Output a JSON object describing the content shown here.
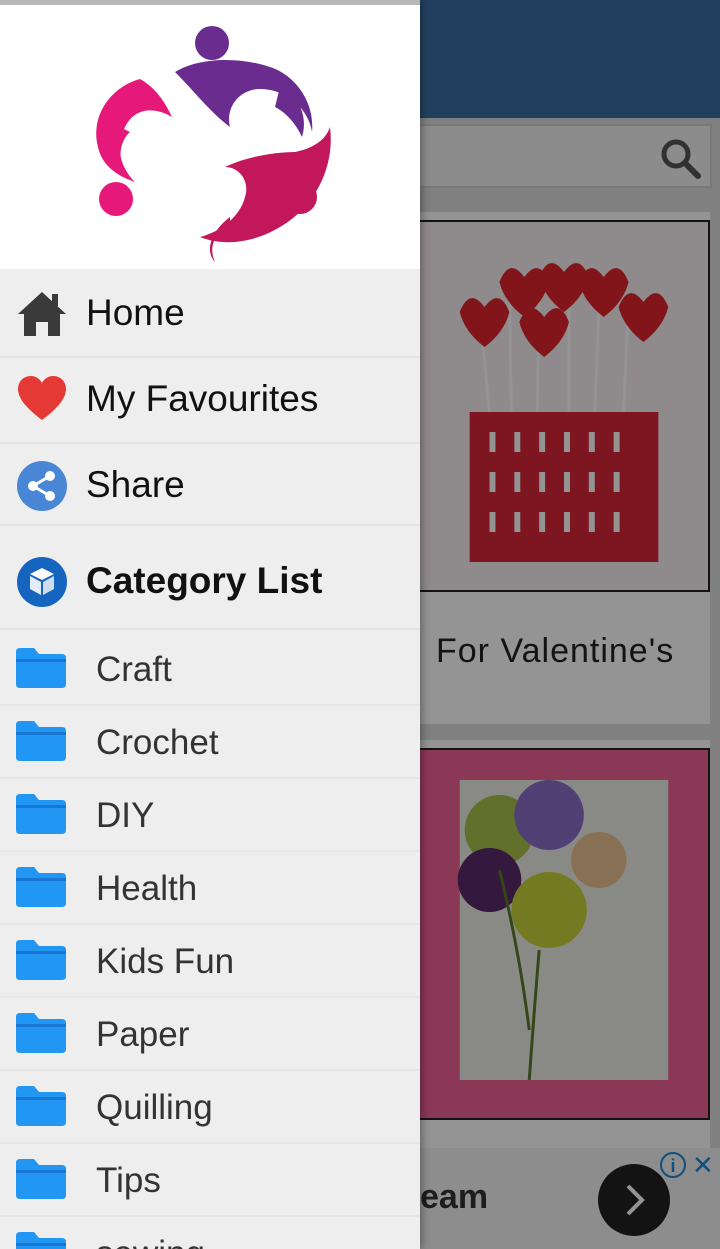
{
  "background_app": {
    "search_icon": "search-icon",
    "card1_title": "For  Valentine's",
    "ad": {
      "text": "eam",
      "info_icon": "info-icon",
      "info_glyph": "i",
      "close_glyph": "✕",
      "next_glyph": "›"
    }
  },
  "drawer": {
    "logo_icon": "community-people-logo",
    "nav_items": [
      {
        "label": "Home",
        "icon": "home-icon"
      },
      {
        "label": "My Favourites",
        "icon": "heart-icon"
      },
      {
        "label": "Share",
        "icon": "share-icon"
      }
    ],
    "category_header": {
      "label": "Category List",
      "icon": "category-cube-icon"
    },
    "categories": [
      {
        "label": "Craft"
      },
      {
        "label": "Crochet"
      },
      {
        "label": "DIY"
      },
      {
        "label": "Health"
      },
      {
        "label": "Kids Fun"
      },
      {
        "label": "Paper"
      },
      {
        "label": "Quilling"
      },
      {
        "label": "Tips"
      },
      {
        "label": "sewing"
      }
    ]
  },
  "colors": {
    "folder": "#2196F3",
    "heart": "#E53935",
    "share_bg": "#4A86D6",
    "category_icon_bg": "#1565C0",
    "logo_pink": "#E6197A",
    "logo_purple": "#6A2C8F",
    "logo_magenta": "#C2185B"
  }
}
